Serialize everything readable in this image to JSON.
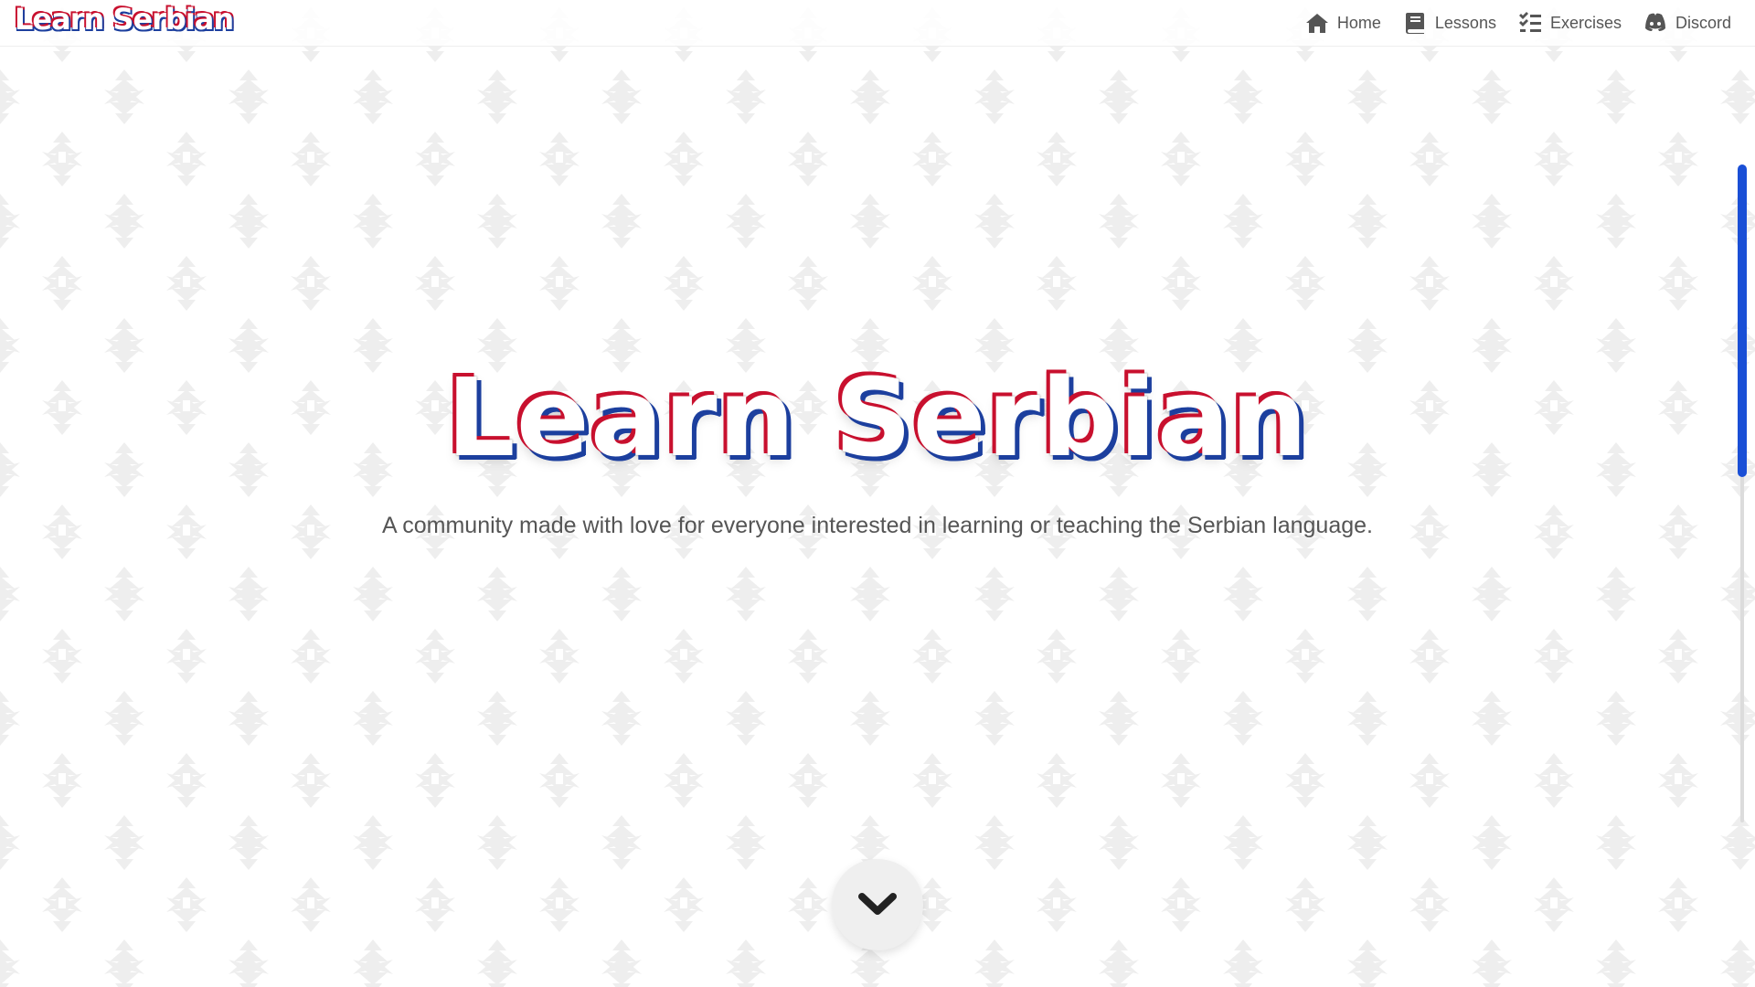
{
  "navbar": {
    "brand": "Learn Serbian",
    "links": [
      {
        "label": "Home",
        "icon": "home-icon"
      },
      {
        "label": "Lessons",
        "icon": "book-icon"
      },
      {
        "label": "Exercises",
        "icon": "checklist-icon"
      },
      {
        "label": "Discord",
        "icon": "discord-icon"
      }
    ]
  },
  "hero": {
    "title": "Learn Serbian",
    "subtitle": "A community made with love for everyone interested in learning or teaching the Serbian language."
  },
  "scroll_button": {
    "icon": "chevron-down-icon"
  },
  "colors": {
    "red": "#c8102e",
    "blue": "#1c3f9e",
    "text": "#555555",
    "scroll_thumb": "#1a4fd6"
  },
  "scroll_position": 0.0
}
